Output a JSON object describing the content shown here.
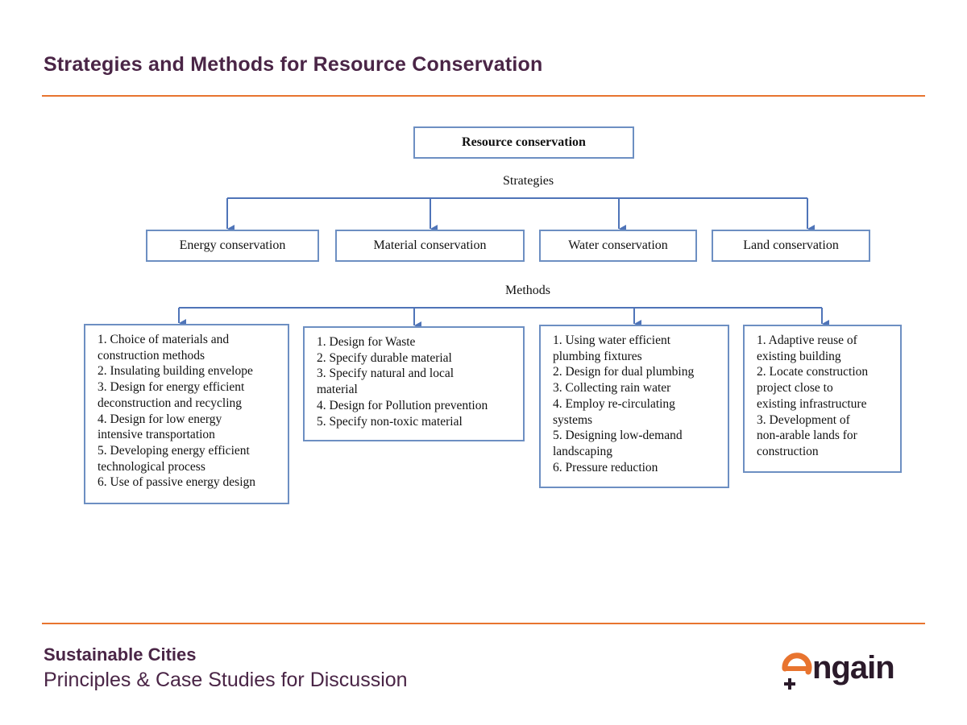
{
  "slide": {
    "title": "Strategies and Methods for Resource Conservation"
  },
  "diagram": {
    "root": "Resource conservation",
    "strategies_label": "Strategies",
    "methods_label": "Methods",
    "strategies": [
      "Energy conservation",
      "Material conservation",
      "Water conservation",
      "Land conservation"
    ],
    "methods": [
      {
        "lines": [
          "1. Choice of materials and",
          "construction methods",
          "2. Insulating building envelope",
          "3. Design for energy efficient",
          "deconstruction and recycling",
          "4. Design for low energy",
          "intensive transportation",
          "5. Developing energy efficient",
          "technological process",
          "6. Use of passive energy design"
        ]
      },
      {
        "lines": [
          "1. Design for Waste",
          "2. Specify durable material",
          "3. Specify natural and local",
          "material",
          "4. Design for Pollution prevention",
          "5. Specify non-toxic material"
        ]
      },
      {
        "lines": [
          "1. Using water efficient",
          "plumbing fixtures",
          "2. Design for dual plumbing",
          "3. Collecting rain water",
          "4. Employ re-circulating",
          "systems",
          "5. Designing low-demand",
          "landscaping",
          "6. Pressure reduction"
        ]
      },
      {
        "lines": [
          "1. Adaptive reuse of",
          "existing building",
          "2. Locate construction",
          "project close to",
          "existing infrastructure",
          "3. Development of",
          "non-arable lands for",
          "construction"
        ]
      }
    ]
  },
  "footer": {
    "title": "Sustainable Cities",
    "subtitle": "Principles & Case Studies for Discussion",
    "logo_text": "engain"
  },
  "colors": {
    "title": "#4a2546",
    "rule": "#e8742f",
    "box_border": "#6d8fc2",
    "connector": "#4f74b8",
    "logo_orange": "#e8742f",
    "logo_dark": "#2b1a2a"
  }
}
